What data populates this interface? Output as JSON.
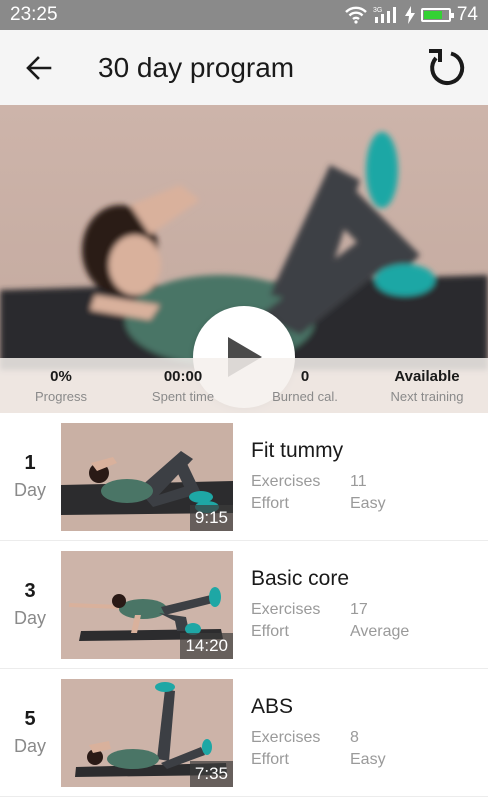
{
  "status_bar": {
    "time": "23:25",
    "network": "3G",
    "battery_level": "74",
    "battery_fraction": 0.74
  },
  "app_bar": {
    "title": "30 day program",
    "back_icon": "arrow-left-icon",
    "refresh_icon": "refresh-icon"
  },
  "hero": {
    "play_icon": "play-icon",
    "stats": [
      {
        "value": "0%",
        "label": "Progress"
      },
      {
        "value": "00:00",
        "label": "Spent time"
      },
      {
        "value": "0",
        "label": "Burned cal."
      },
      {
        "value": "Available",
        "label": "Next training"
      }
    ]
  },
  "labels": {
    "day": "Day",
    "exercises": "Exercises",
    "effort": "Effort"
  },
  "workouts": [
    {
      "day": "1",
      "name": "Fit tummy",
      "duration": "9:15",
      "exercises": "11",
      "effort": "Easy"
    },
    {
      "day": "3",
      "name": "Basic core",
      "duration": "14:20",
      "exercises": "17",
      "effort": "Average"
    },
    {
      "day": "5",
      "name": "ABS",
      "duration": "7:35",
      "exercises": "8",
      "effort": "Easy"
    }
  ],
  "colors": {
    "accent": "#1ea7a5",
    "outfit": "#4a7566",
    "leggings": "#3c3f44",
    "battery": "#35d135"
  }
}
